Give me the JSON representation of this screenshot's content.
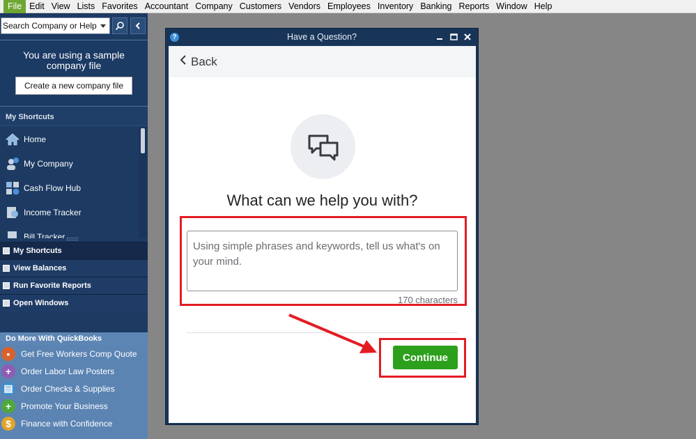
{
  "menu": [
    "File",
    "Edit",
    "View",
    "Lists",
    "Favorites",
    "Accountant",
    "Company",
    "Customers",
    "Vendors",
    "Employees",
    "Inventory",
    "Banking",
    "Reports",
    "Window",
    "Help"
  ],
  "search": {
    "placeholder": "Search Company or Help"
  },
  "sample": {
    "line1": "You are using a sample",
    "line2": "company file",
    "create_button": "Create a new company file"
  },
  "shortcuts": {
    "header": "My Shortcuts",
    "items": [
      {
        "label": "Home",
        "icon": "home-icon"
      },
      {
        "label": "My Company",
        "icon": "company-icon"
      },
      {
        "label": "Cash Flow Hub",
        "icon": "cash-flow-icon"
      },
      {
        "label": "Income Tracker",
        "icon": "income-tracker-icon"
      },
      {
        "label": "Bill Tracker",
        "icon": "bill-tracker-icon"
      }
    ]
  },
  "nav_tabs": [
    "My Shortcuts",
    "View Balances",
    "Run Favorite Reports",
    "Open Windows"
  ],
  "do_more": {
    "header": "Do More With QuickBooks",
    "items": [
      {
        "label": "Get Free Workers Comp Quote",
        "color": "#d9622b"
      },
      {
        "label": "Order Labor Law Posters",
        "color": "#8e5bb5"
      },
      {
        "label": "Order Checks & Supplies",
        "color": "#3e8fcb"
      },
      {
        "label": "Promote Your Business",
        "color": "#4fa83d"
      },
      {
        "label": "Finance with Confidence",
        "color": "#e0a52a"
      }
    ]
  },
  "dialog": {
    "title": "Have a Question?",
    "back": "Back",
    "headline": "What can we help you with?",
    "textarea_placeholder": "Using simple phrases and keywords, tell us what's on your mind.",
    "char_count": "170 characters",
    "continue": "Continue"
  },
  "colors": {
    "accent_green": "#2ca01c",
    "annotation_red": "#e31c23",
    "nav_blue": "#1c3a62"
  }
}
